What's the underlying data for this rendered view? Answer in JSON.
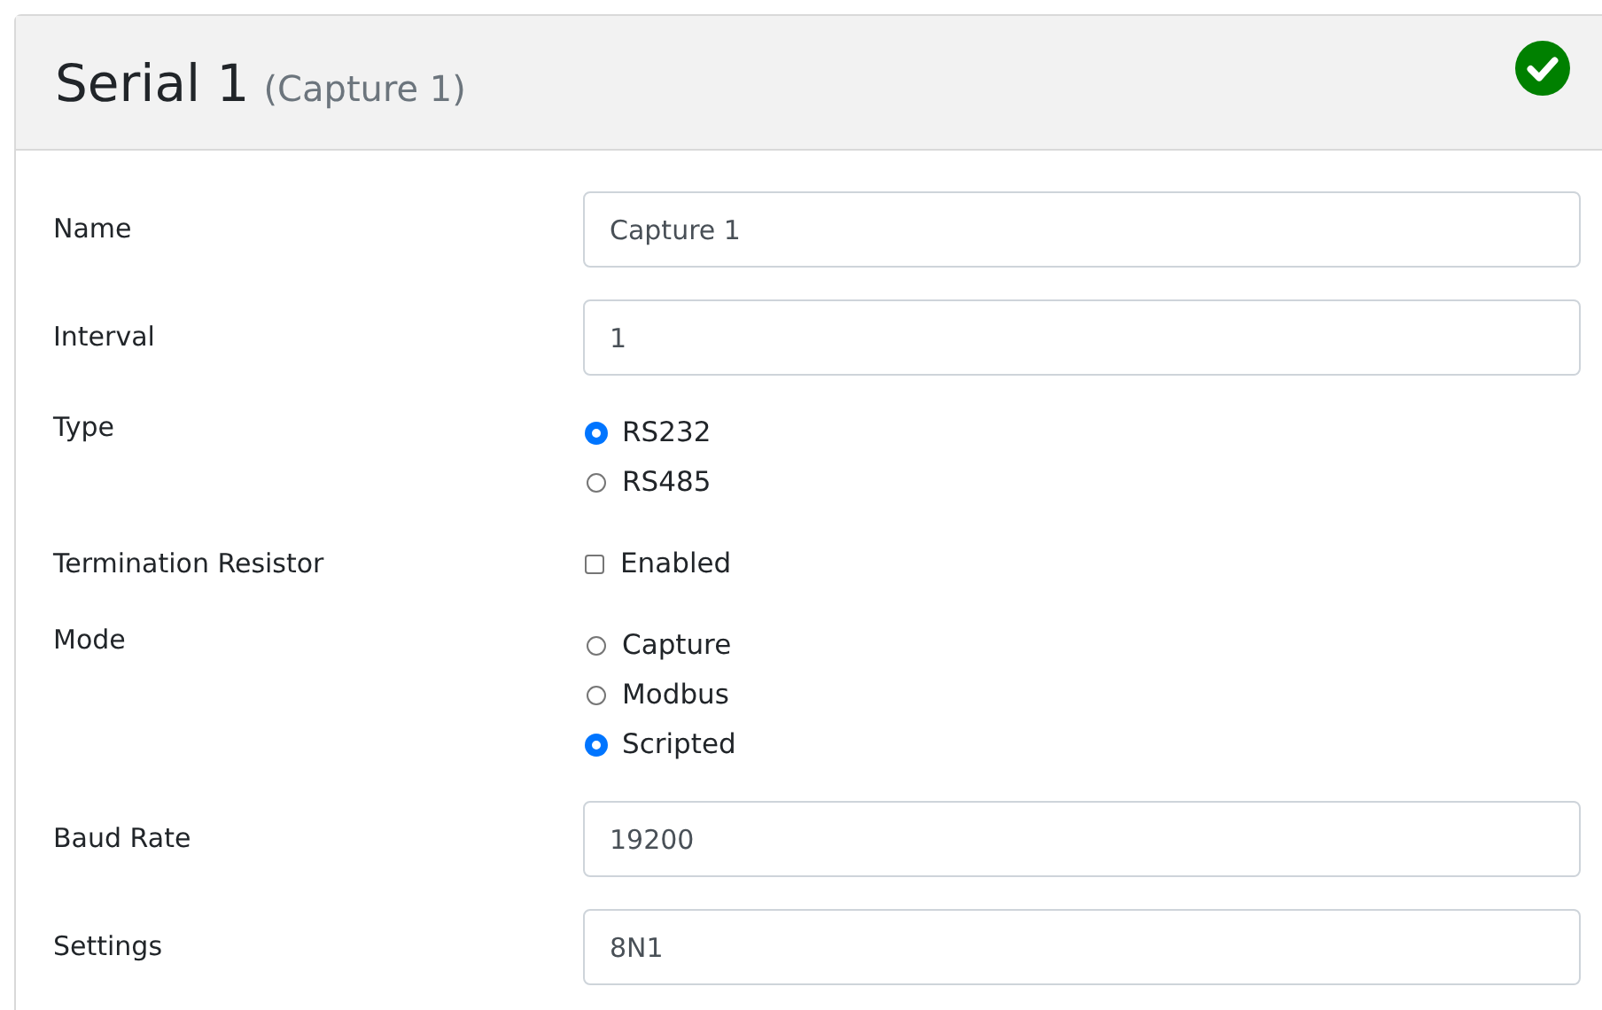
{
  "header": {
    "title": "Serial 1",
    "subtitle": "(Capture 1)",
    "valid": true
  },
  "rows": [
    {
      "kind": "text",
      "label": "Name",
      "value": "Capture 1"
    },
    {
      "kind": "text",
      "label": "Interval",
      "value": "1"
    },
    {
      "kind": "radio",
      "label": "Type",
      "options": [
        {
          "label": "RS232",
          "selected": true
        },
        {
          "label": "RS485",
          "selected": false
        }
      ]
    },
    {
      "kind": "checkbox",
      "label": "Termination Resistor",
      "option": "Enabled",
      "checked": false
    },
    {
      "kind": "radio",
      "label": "Mode",
      "options": [
        {
          "label": "Capture",
          "selected": false
        },
        {
          "label": "Modbus",
          "selected": false
        },
        {
          "label": "Scripted",
          "selected": true
        }
      ]
    },
    {
      "kind": "text",
      "label": "Baud Rate",
      "value": "19200"
    },
    {
      "kind": "text",
      "label": "Settings",
      "value": "8N1"
    }
  ]
}
